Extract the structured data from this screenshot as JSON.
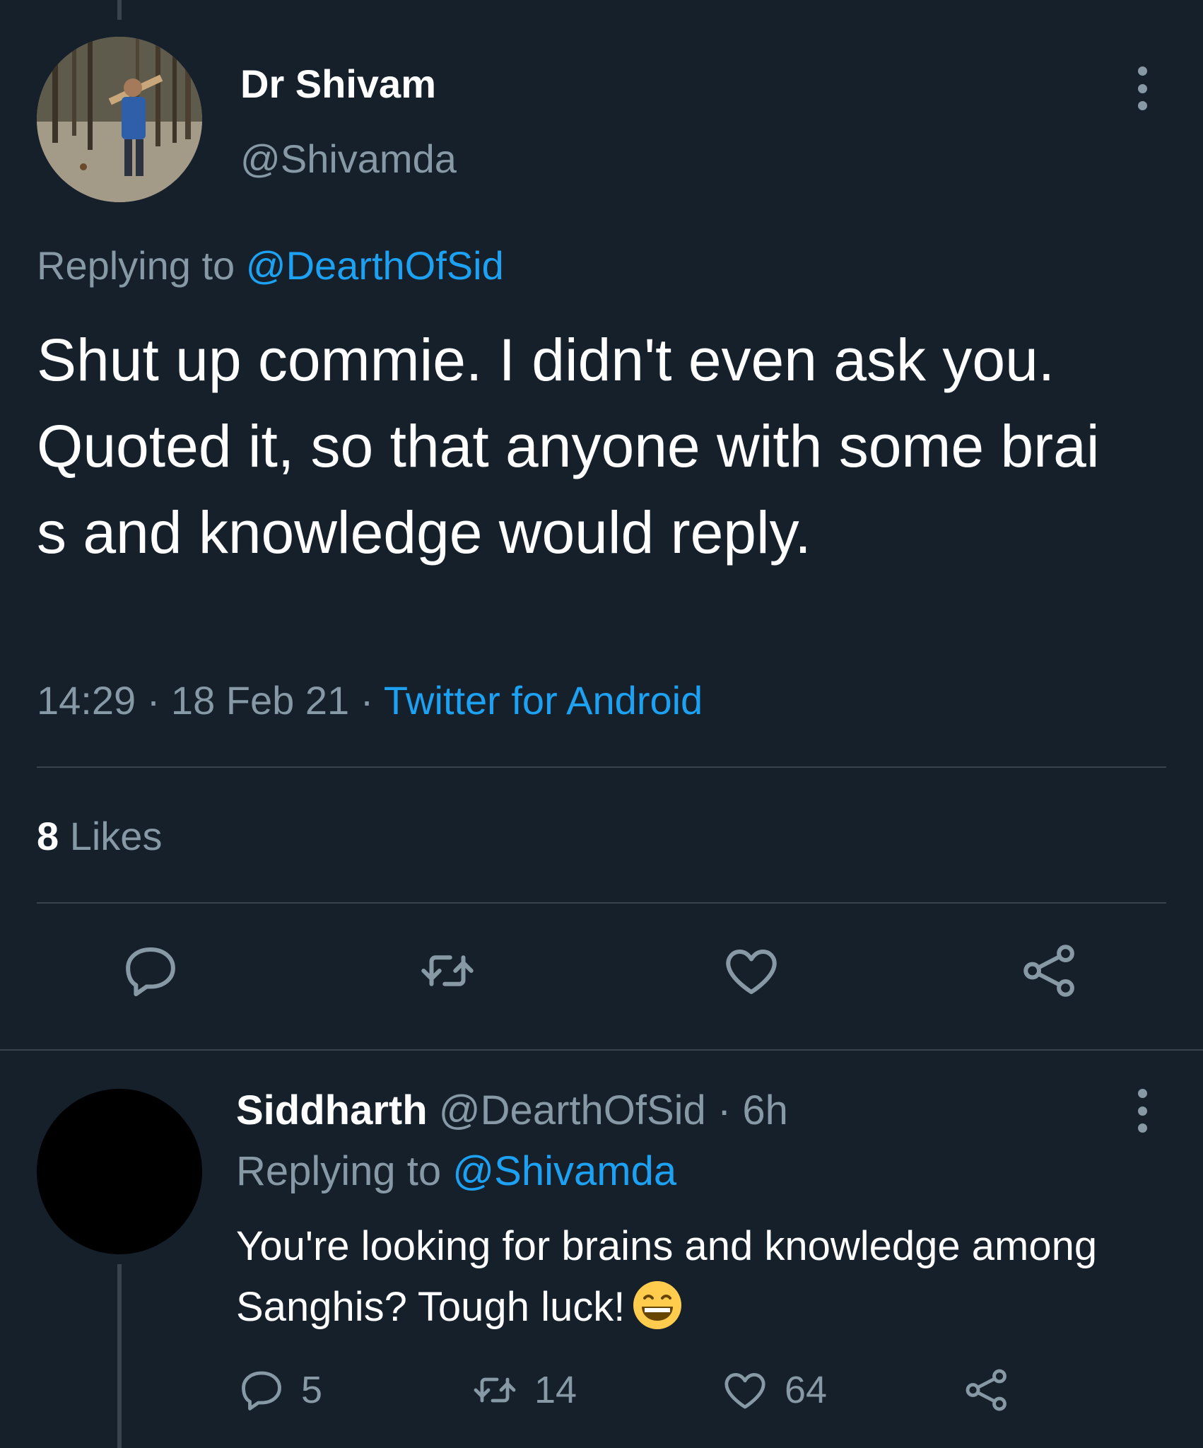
{
  "main_tweet": {
    "display_name": "Dr Shivam",
    "handle": "@Shivamda",
    "replying_prefix": "Replying to",
    "replying_to": "@DearthOfSid",
    "text": "Shut up commie. I didn't even ask you. Quoted it, so that anyone with some brai s and knowledge would reply.",
    "time": "14:29",
    "separator": "·",
    "date": "18 Feb 21",
    "source": "Twitter for Android",
    "likes_count": "8",
    "likes_label": "Likes"
  },
  "reply_tweet": {
    "display_name": "Siddharth",
    "handle": "@DearthOfSid",
    "separator": "·",
    "age": "6h",
    "replying_prefix": "Replying to",
    "replying_to": "@Shivamda",
    "text": "You're looking for brains and knowledge among Sanghis? Tough luck!",
    "emoji": "grinning-face-emoji",
    "reply_count": "5",
    "retweet_count": "14",
    "like_count": "64"
  },
  "icons": {
    "reply": "reply-icon",
    "retweet": "retweet-icon",
    "like": "heart-icon",
    "share": "share-icon",
    "more": "more-options-icon"
  },
  "colors": {
    "background": "#15202b",
    "text": "#ffffff",
    "secondary_text": "#8899a6",
    "link": "#1da1f2",
    "divider": "#38444d",
    "emoji_yellow": "#ffcc4d"
  }
}
